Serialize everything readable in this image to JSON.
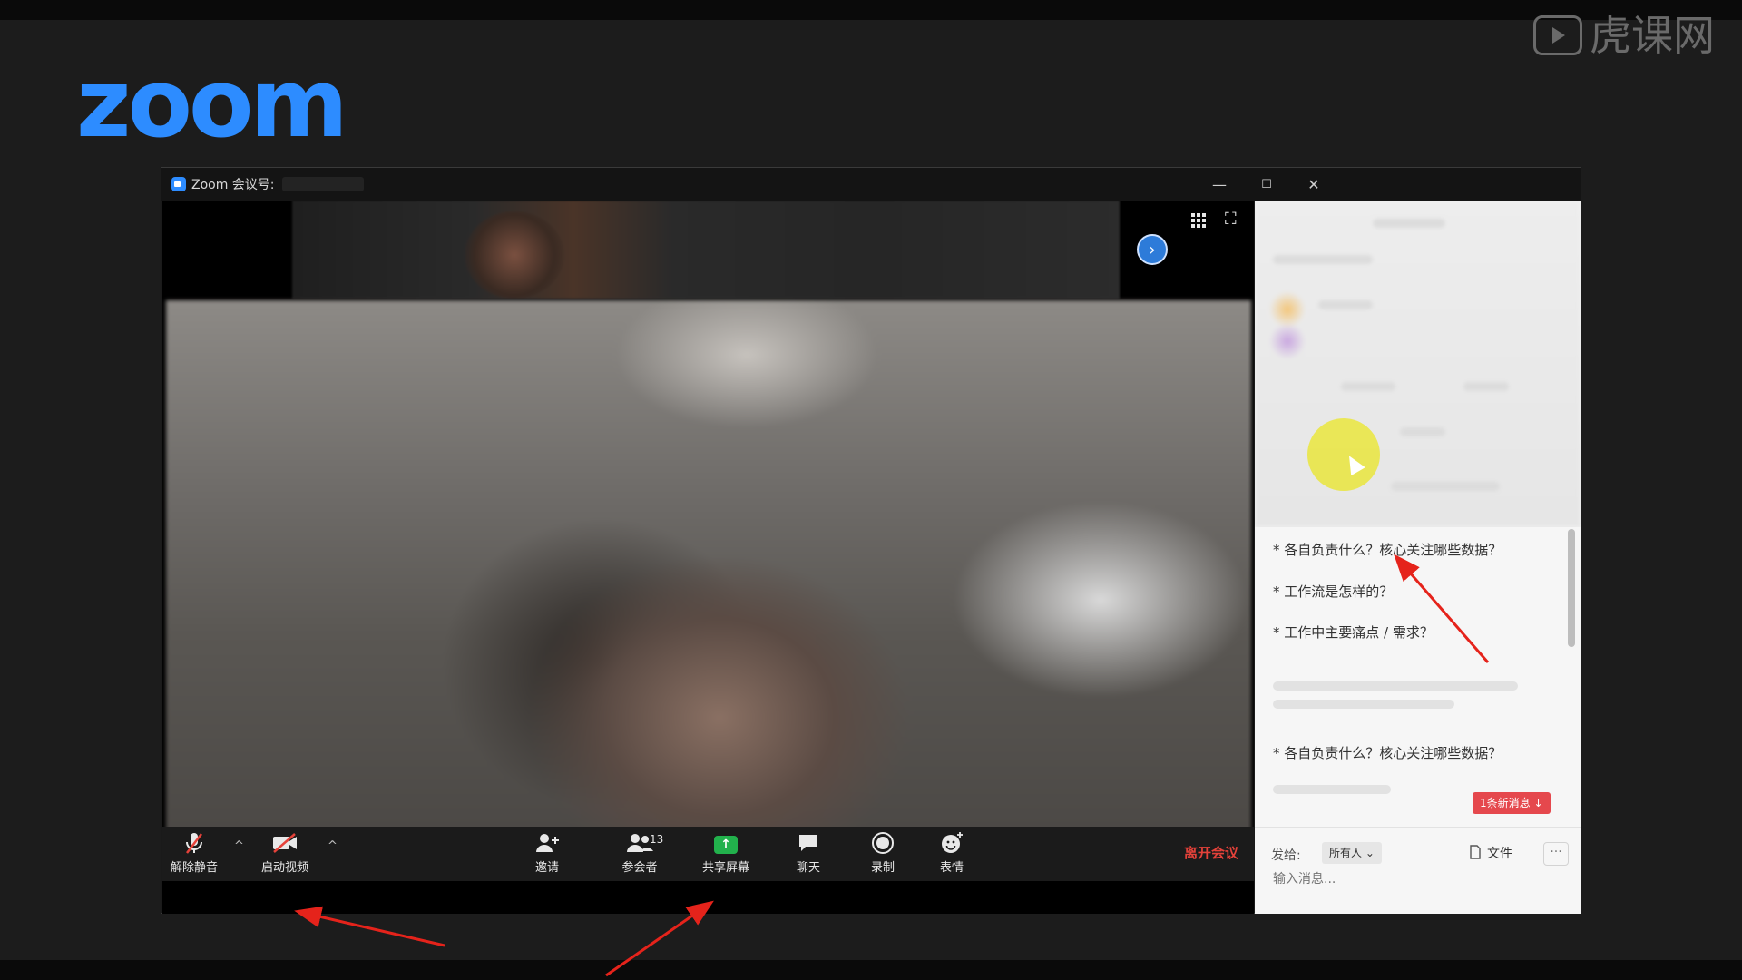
{
  "background": {
    "color": "#1c1c1c"
  },
  "logo": {
    "text": "zoom",
    "color": "#2d8cff"
  },
  "watermark": {
    "text": "虎课网"
  },
  "window": {
    "title": "Zoom 会议号:",
    "controls": {
      "minimize": "—",
      "maximize": "☐",
      "close": "✕"
    }
  },
  "video": {
    "next_page_glyph": "›",
    "fullscreen_glyph": "⛶"
  },
  "toolbar": {
    "unmute_label": "解除静音",
    "start_video_label": "启动视频",
    "invite_label": "邀请",
    "participants_label": "参会者",
    "participants_count": "13",
    "share_label": "共享屏幕",
    "chat_label": "聊天",
    "record_label": "录制",
    "reactions_label": "表情",
    "leave_label": "离开会议",
    "caret": "^"
  },
  "chat": {
    "messages": [
      "* 各自负责什么？核心关注哪些数据？",
      "* 工作流是怎样的？",
      "* 工作中主要痛点 / 需求？",
      "* 各自负责什么？核心关注哪些数据？"
    ],
    "new_message_badge": "1条新消息 ↓",
    "send_to_label": "发给:",
    "recipient": "所有人 ⌄",
    "file_label": "文件",
    "more_label": "···",
    "input_placeholder": "输入消息..."
  },
  "annotations": {
    "arrow_color": "#e5231b"
  }
}
